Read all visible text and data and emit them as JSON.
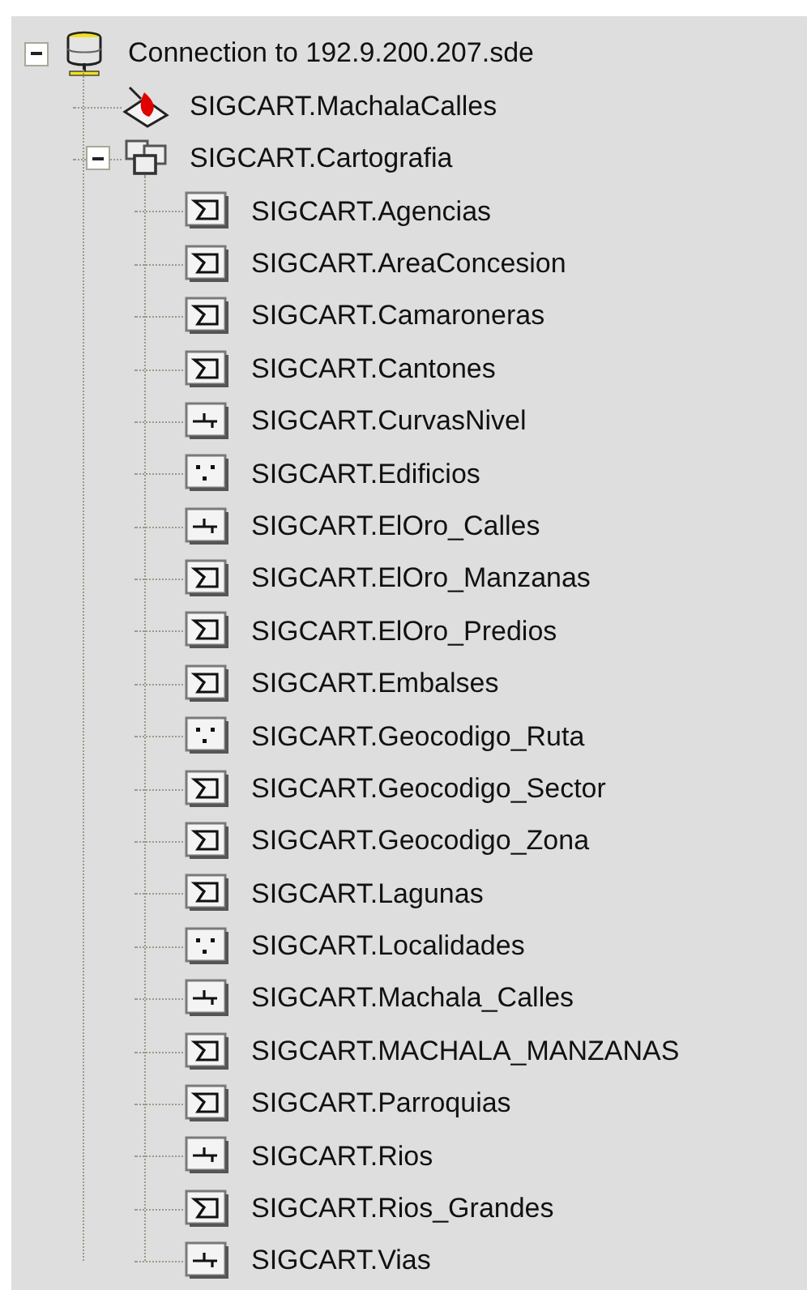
{
  "tree": [
    {
      "label": "Connection to 192.9.200.207.sde",
      "kind": "connection",
      "expanded": true,
      "children": [
        {
          "label": "SIGCART.MachalaCalles",
          "kind": "network"
        },
        {
          "label": "SIGCART.Cartografia",
          "kind": "dataset",
          "expanded": true,
          "children": [
            {
              "label": "SIGCART.Agencias",
              "kind": "polygon"
            },
            {
              "label": "SIGCART.AreaConcesion",
              "kind": "polygon"
            },
            {
              "label": "SIGCART.Camaroneras",
              "kind": "polygon"
            },
            {
              "label": "SIGCART.Cantones",
              "kind": "polygon"
            },
            {
              "label": "SIGCART.CurvasNivel",
              "kind": "line"
            },
            {
              "label": "SIGCART.Edificios",
              "kind": "point"
            },
            {
              "label": "SIGCART.ElOro_Calles",
              "kind": "line"
            },
            {
              "label": "SIGCART.ElOro_Manzanas",
              "kind": "polygon"
            },
            {
              "label": "SIGCART.ElOro_Predios",
              "kind": "polygon"
            },
            {
              "label": "SIGCART.Embalses",
              "kind": "polygon"
            },
            {
              "label": "SIGCART.Geocodigo_Ruta",
              "kind": "point"
            },
            {
              "label": "SIGCART.Geocodigo_Sector",
              "kind": "polygon"
            },
            {
              "label": "SIGCART.Geocodigo_Zona",
              "kind": "polygon"
            },
            {
              "label": "SIGCART.Lagunas",
              "kind": "polygon"
            },
            {
              "label": "SIGCART.Localidades",
              "kind": "point"
            },
            {
              "label": "SIGCART.Machala_Calles",
              "kind": "line"
            },
            {
              "label": "SIGCART.MACHALA_MANZANAS",
              "kind": "polygon"
            },
            {
              "label": "SIGCART.Parroquias",
              "kind": "polygon"
            },
            {
              "label": "SIGCART.Rios",
              "kind": "line"
            },
            {
              "label": "SIGCART.Rios_Grandes",
              "kind": "polygon"
            },
            {
              "label": "SIGCART.Vias",
              "kind": "line"
            }
          ]
        }
      ]
    }
  ]
}
